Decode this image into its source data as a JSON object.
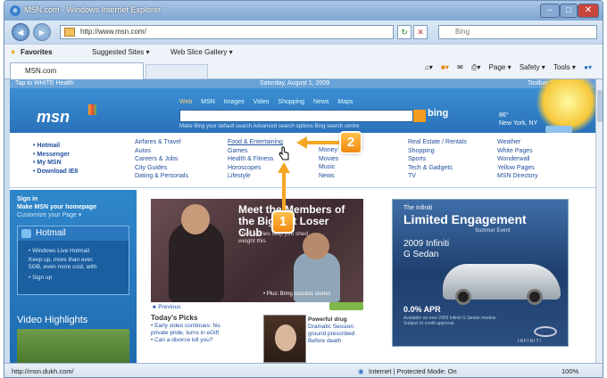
{
  "window": {
    "title": "MSN.com - Windows Internet Explorer"
  },
  "nav": {
    "address": "http://www.msn.com/",
    "search_placeholder": "Bing"
  },
  "favbar": {
    "favorites": "Favorites",
    "suggested": "Suggested Sites ▾",
    "webslice": "Web Slice Gallery ▾"
  },
  "tab": {
    "label": "MSN.com"
  },
  "commands": [
    "Page ▾",
    "Safety ▾",
    "Tools ▾"
  ],
  "msn": {
    "topbar_left": "Tap to WHITE Health",
    "topbar_date": "Saturday, August 1, 2009",
    "topbar_right": "Toolbar  Español",
    "logo": "msn",
    "search_tabs": [
      "Web",
      "MSN",
      "Images",
      "Video",
      "Shopping",
      "News",
      "Maps"
    ],
    "bing": "bing",
    "search_sub": "Make Bing your default search   Advanced search options   Bing search centre",
    "weather": {
      "temp": "86°",
      "city": "New York, NY"
    }
  },
  "links": {
    "col1": [
      "• Hotmail",
      "• Messenger",
      "• My MSN",
      "• Download IE8"
    ],
    "col2": [
      "Airfares & Travel",
      "Autos",
      "Careers & Jobs",
      "City Guides",
      "Dating & Personals"
    ],
    "col3": [
      "Food & Entertaining",
      "Games",
      "Health & Fitness",
      "Horoscopes",
      "Lifestyle"
    ],
    "col4": [
      "Money",
      "Movies",
      "Music",
      "News"
    ],
    "col5": [
      "Real Estate / Rentals",
      "Shopping",
      "Sports",
      "Tech & Gadgets",
      "TV"
    ],
    "col6": [
      "Weather",
      "White Pages",
      "Wonderwall",
      "Yellow Pages",
      "MSN Directory"
    ]
  },
  "sidebar": {
    "signin": "Sign in",
    "make": "Make MSN your homepage",
    "customize": "Customize your Page  ▾",
    "hotmail_title": "Hotmail",
    "hotmail_lines": [
      "• Windows Live Hotmail",
      "Keep up, more than ever.",
      "5GB, even more cost, with",
      "• Sign up"
    ],
    "video_title": "Video Highlights"
  },
  "feature": {
    "title": "Meet the Members of the Biggest Loser Club",
    "sub": "Their stories help you shed weight this",
    "caption": "• Plus: Bring success stories",
    "previous": "◄ Previous",
    "watch": "Watch"
  },
  "picks": {
    "title": "Today's Picks",
    "items": [
      "• Early video continues: his",
      "  private pride, turns in eGift",
      "• Can a divorce kill you?"
    ]
  },
  "shop": {
    "title": "Powerful drug",
    "lines": [
      "Dramatic Session",
      "ground prescribed",
      "Before death"
    ]
  },
  "ad": {
    "brand": "The Infiniti",
    "headline": "Limited Engagement",
    "event": "Summer Event",
    "model_line1": "2009 Infiniti",
    "model_line2": "G Sedan",
    "apr": "0.0% APR",
    "fine": "Available on new 2009 Infiniti G Sedan models. Subject to credit approval.",
    "maker": "INFINITI"
  },
  "status": {
    "url": "http://msn.dukh.com/",
    "zone": "Internet | Protected Mode: On",
    "zoom": "100%"
  },
  "callouts": {
    "step1": "1",
    "step2": "2"
  }
}
